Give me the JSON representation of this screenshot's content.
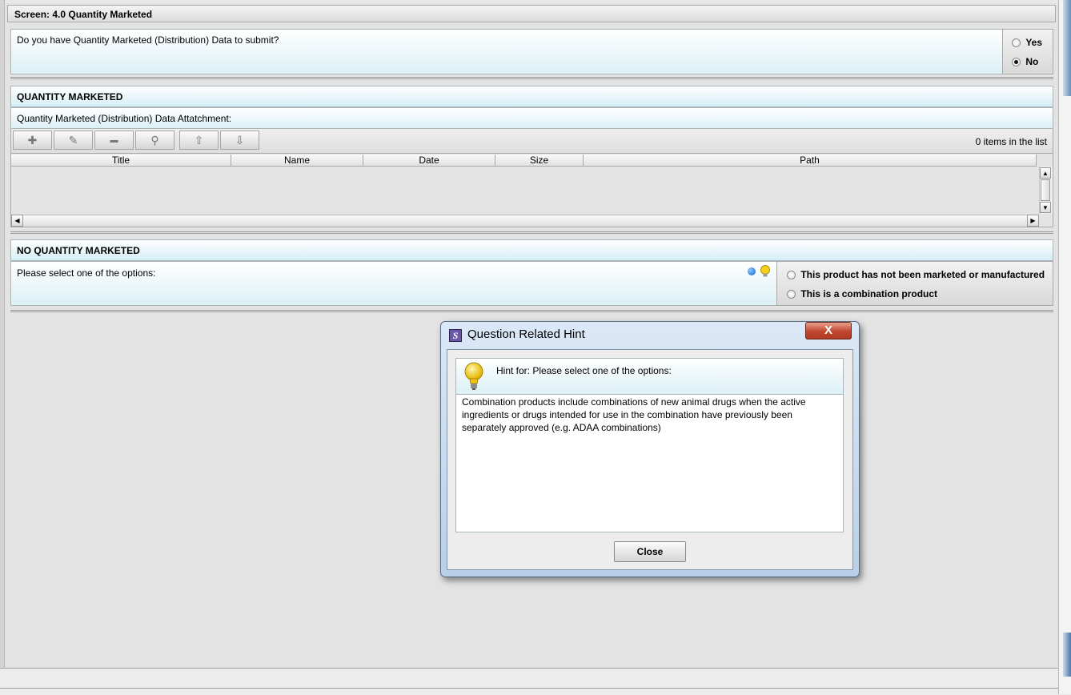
{
  "screen": {
    "title": "Screen: 4.0 Quantity Marketed"
  },
  "question1": {
    "text": "Do you have Quantity Marketed (Distribution) Data to submit?",
    "options": [
      {
        "label": "Yes",
        "selected": false
      },
      {
        "label": "No",
        "selected": true
      }
    ]
  },
  "quantity_marketed": {
    "header": "QUANTITY MARKETED",
    "attachment_label": "Quantity Marketed (Distribution) Data Attatchment:",
    "toolbar": {
      "buttons": [
        {
          "name": "add-button",
          "icon": "plus-icon",
          "glyph": "✚"
        },
        {
          "name": "edit-button",
          "icon": "pencil-icon",
          "glyph": "✎"
        },
        {
          "name": "remove-button",
          "icon": "minus-icon",
          "glyph": "▬"
        },
        {
          "name": "view-button",
          "icon": "magnifier-icon",
          "glyph": "⚲"
        },
        {
          "name": "move-up-button",
          "icon": "arrow-up-icon",
          "glyph": "⇧"
        },
        {
          "name": "move-down-button",
          "icon": "arrow-down-icon",
          "glyph": "⇩"
        }
      ],
      "count_text": "0 items in the list"
    },
    "table": {
      "columns": [
        "Title",
        "Name",
        "Date",
        "Size",
        "Path"
      ],
      "rows": []
    }
  },
  "no_quantity_marketed": {
    "header": "NO QUANTITY MARKETED",
    "prompt": "Please select one of the options:",
    "options": [
      {
        "label": "This product has not been marketed or manufactured",
        "selected": false
      },
      {
        "label": "This is a combination product",
        "selected": false
      }
    ],
    "icons": {
      "required": "blue-dot-icon",
      "hint": "lightbulb-icon"
    }
  },
  "dialog": {
    "title": "Question Related Hint",
    "close_x": "X",
    "hint_for": "Hint for: Please select one of the options:",
    "hint_text": "Combination products include combinations of new animal drugs when the active ingredients or drugs intended for use in the combination have previously been separately approved (e.g. ADAA combinations)",
    "close_button": "Close",
    "app_icon": "S"
  },
  "colors": {
    "accent": "#d5eef6",
    "close": "#c0472e"
  }
}
